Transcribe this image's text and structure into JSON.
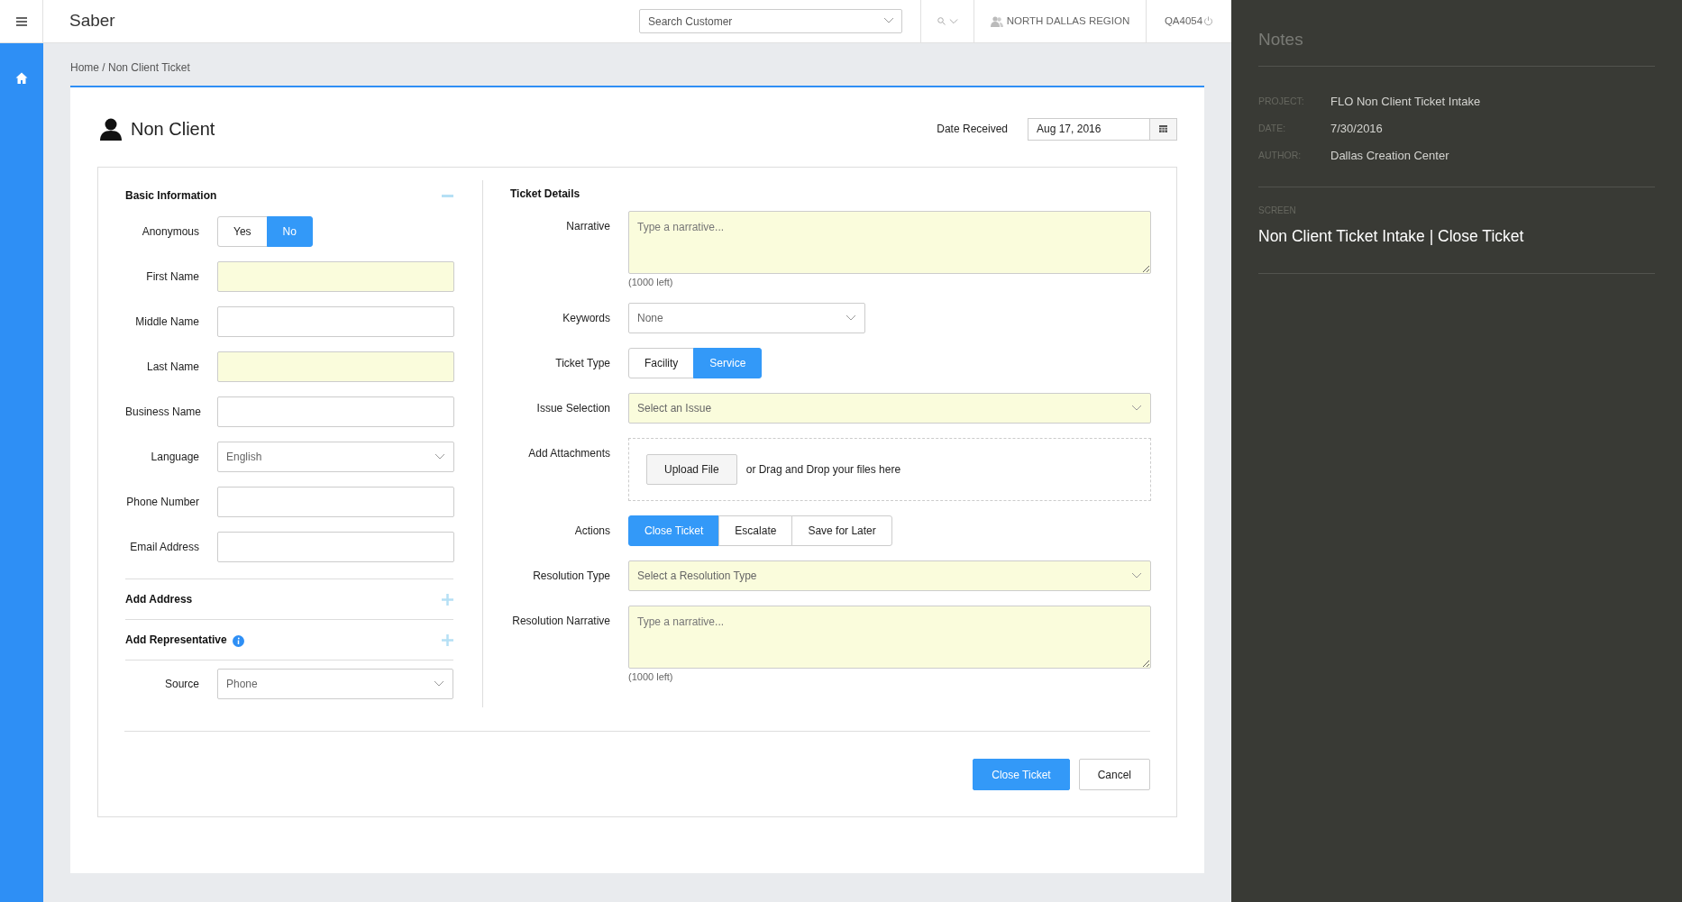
{
  "header": {
    "brand": "Saber",
    "search": {
      "placeholder": "Search Customer"
    },
    "region": "NORTH DALLAS REGION",
    "user": "QA4054"
  },
  "breadcrumb": "Home / Non Client Ticket",
  "form": {
    "title": "Non Client",
    "date_received": {
      "label": "Date Received",
      "value": "Aug 17, 2016"
    },
    "basic_information": {
      "title": "Basic Information",
      "expanded": true,
      "fields": [
        {
          "kind": "toggle",
          "label": "Anonymous",
          "options": [
            {
              "label": "Yes",
              "selected": false
            },
            {
              "label": "No",
              "selected": true
            }
          ]
        },
        {
          "kind": "text",
          "label": "First Name",
          "required": true
        },
        {
          "kind": "text",
          "label": "Middle Name",
          "required": false
        },
        {
          "kind": "text",
          "label": "Last Name",
          "required": true
        },
        {
          "kind": "text",
          "label": "Business Name",
          "required": false
        },
        {
          "kind": "select",
          "label": "Language",
          "value": "English",
          "required": false
        },
        {
          "kind": "text",
          "label": "Phone Number",
          "required": false
        },
        {
          "kind": "text",
          "label": "Email Address",
          "required": false
        }
      ],
      "sections": [
        {
          "title": "Add Address",
          "info": false
        },
        {
          "title": "Add Representative",
          "info": true
        }
      ],
      "source": {
        "label": "Source",
        "value": "Phone"
      }
    },
    "ticket_details": {
      "title": "Ticket Details",
      "fields": [
        {
          "kind": "textarea",
          "label": "Narrative",
          "placeholder": "Type a narrative...",
          "counter": "(1000 left)",
          "required": true
        },
        {
          "kind": "select",
          "label": "Keywords",
          "value": "None",
          "required": false
        },
        {
          "kind": "toggle",
          "label": "Ticket Type",
          "options": [
            {
              "label": "Facility",
              "selected": false
            },
            {
              "label": "Service",
              "selected": true
            }
          ]
        },
        {
          "kind": "select",
          "label": "Issue Selection",
          "value": "Select an Issue",
          "required": true
        },
        {
          "kind": "attachments",
          "label": "Add Attachments",
          "button": "Upload File",
          "hint": "or Drag and Drop your files here"
        },
        {
          "kind": "toggle",
          "label": "Actions",
          "options": [
            {
              "label": "Close Ticket",
              "selected": true
            },
            {
              "label": "Escalate",
              "selected": false
            },
            {
              "label": "Save for Later",
              "selected": false
            }
          ]
        },
        {
          "kind": "select",
          "label": "Resolution Type",
          "value": "Select a Resolution Type",
          "required": true
        },
        {
          "kind": "textarea",
          "label": "Resolution Narrative",
          "placeholder": "Type a narrative...",
          "counter": "(1000 left)",
          "required": true
        }
      ]
    },
    "buttons": [
      {
        "label": "Close Ticket",
        "primary": true
      },
      {
        "label": "Cancel",
        "primary": false
      }
    ]
  },
  "notes": {
    "title": "Notes",
    "meta": [
      {
        "label": "PROJECT:",
        "value": "FLO Non Client Ticket Intake"
      },
      {
        "label": "DATE:",
        "value": "7/30/2016"
      },
      {
        "label": "AUTHOR:",
        "value": "Dallas Creation Center"
      }
    ],
    "screen_label": "SCREEN",
    "screen_value": "Non Client Ticket Intake | Close Ticket"
  }
}
